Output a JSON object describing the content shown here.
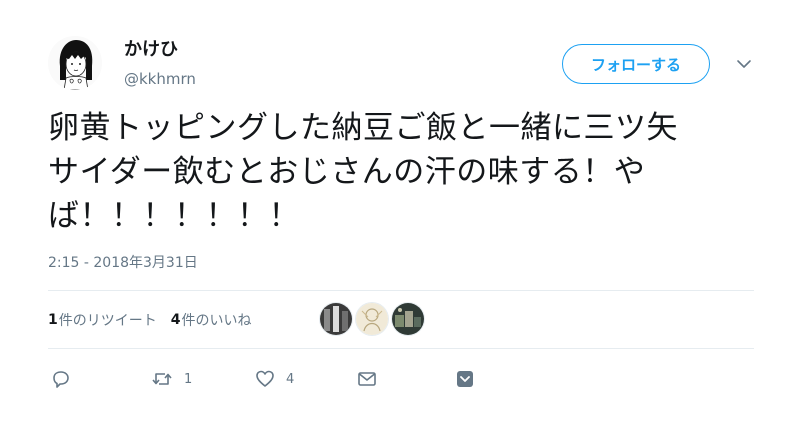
{
  "user": {
    "display_name": "かけひ",
    "username": "@kkhmrn"
  },
  "follow_button": {
    "label": "フォローする"
  },
  "tweet": {
    "lines": [
      "卵黄トッピングした納豆ご飯と一緒に三ツ矢",
      "サイダー飲むとおじさんの汗の味する！や",
      "ば！！！！！！！"
    ],
    "timestamp": "2:15 - 2018年3月31日"
  },
  "stats": {
    "retweets": {
      "count": "1",
      "label": "件のリツイート"
    },
    "likes": {
      "count": "4",
      "label": "件のいいね"
    }
  },
  "actions": {
    "reply": {
      "icon": "reply-icon"
    },
    "retweet": {
      "icon": "retweet-icon",
      "count": "1"
    },
    "like": {
      "icon": "heart-icon",
      "count": "4"
    },
    "message": {
      "icon": "envelope-icon"
    },
    "more": {
      "icon": "chevron-down-icon"
    }
  },
  "colors": {
    "accent": "#1da1f2",
    "text": "#14171a",
    "muted": "#657786",
    "divider": "#e6ecf0"
  }
}
